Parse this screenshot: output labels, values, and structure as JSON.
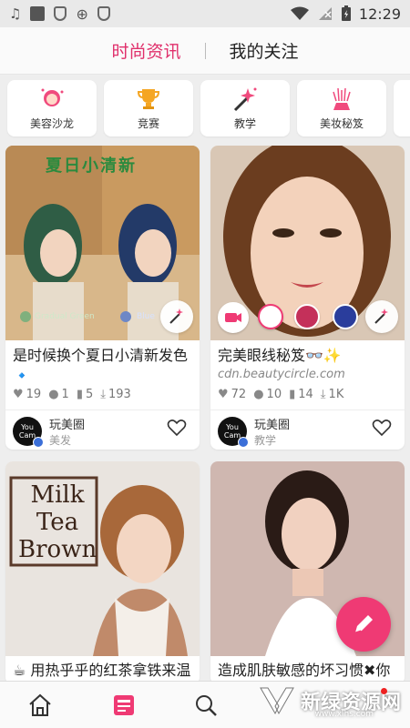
{
  "status_bar": {
    "time": "12:29"
  },
  "top_tabs": [
    {
      "label": "时尚资讯",
      "active": true
    },
    {
      "label": "我的关注",
      "active": false
    }
  ],
  "categories": [
    {
      "label": "美容沙龙",
      "icon": "salon-icon"
    },
    {
      "label": "竞赛",
      "icon": "trophy-icon"
    },
    {
      "label": "教学",
      "icon": "magic-wand-icon"
    },
    {
      "label": "美妆秘笈",
      "icon": "sparkle-icon"
    }
  ],
  "cards": [
    {
      "image_text": "夏日小清新",
      "image_labels": [
        "Gradual Green",
        "Blue"
      ],
      "title": "是时候换个夏日小清新发色🔹",
      "stats": {
        "likes": "19",
        "comments": "1",
        "saves": "5",
        "downloads": "193"
      },
      "author": {
        "name": "玩美圈",
        "tag": "美发",
        "avatar": "You Cam"
      }
    },
    {
      "title": "完美眼线秘笈👓✨",
      "subtitle": "cdn.beautycircle.com",
      "stats": {
        "likes": "72",
        "comments": "10",
        "saves": "14",
        "downloads": "1K"
      },
      "author": {
        "name": "玩美圈",
        "tag": "教学",
        "avatar": "You Cam"
      }
    },
    {
      "image_text": [
        "Milk",
        "Tea",
        "Brown"
      ],
      "title": "☕ 用热乎乎的红茶拿铁来温"
    },
    {
      "title": "造成肌肤敏感的坏习惯✖你"
    }
  ],
  "colors": {
    "accent": "#e02f6b",
    "fab": "#ef3a74",
    "swatches": [
      "#ffffff",
      "#c4305a",
      "#2a3d9c"
    ]
  },
  "watermark": {
    "text": "新绿资源网",
    "sub": "www.xlhs.com"
  }
}
